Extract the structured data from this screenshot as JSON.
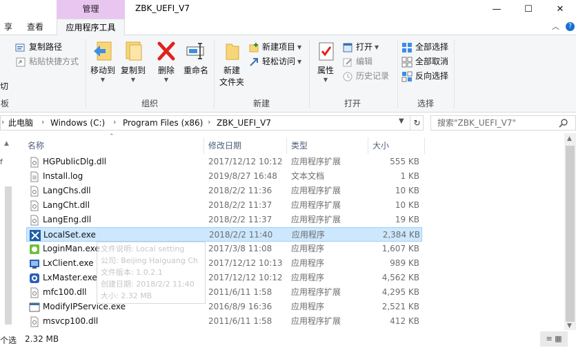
{
  "window": {
    "title": "ZBK_UEFI_V7",
    "context_group": "管理",
    "minimize": "—",
    "maximize": "☐",
    "close": "✕"
  },
  "tabs": {
    "share_partial": "享",
    "view": "查看",
    "app_tools": "应用程序工具",
    "collapse": "︿",
    "help": "?"
  },
  "ribbon": {
    "clipboard": {
      "copy_path": "复制路径",
      "paste_shortcut": "粘贴快捷方式",
      "cut_partial": "切",
      "group_partial": "板"
    },
    "organize": {
      "label": "组织",
      "move_to": "移动到",
      "copy_to": "复制到",
      "delete": "删除",
      "rename": "重命名"
    },
    "new": {
      "label": "新建",
      "new_folder_l1": "新建",
      "new_folder_l2": "文件夹",
      "new_item": "新建项目",
      "easy_access": "轻松访问"
    },
    "open": {
      "label": "打开",
      "properties": "属性",
      "open": "打开",
      "edit": "编辑",
      "history": "历史记录"
    },
    "select": {
      "label": "选择",
      "select_all": "全部选择",
      "select_none": "全部取消",
      "invert": "反向选择"
    }
  },
  "address": {
    "crumbs": [
      "此电脑",
      "Windows (C:)",
      "Program Files (x86)",
      "ZBK_UEFI_V7"
    ],
    "refresh": "↻",
    "search_placeholder": "搜索\"ZBK_UEFI_V7\""
  },
  "columns": [
    "名称",
    "修改日期",
    "类型",
    "大小"
  ],
  "files": [
    {
      "name": "HGPublicDlg.dll",
      "date": "2017/12/12 10:12",
      "type": "应用程序扩展",
      "size": "555 KB",
      "icon": "dll-file-icon"
    },
    {
      "name": "Install.log",
      "date": "2019/8/27 16:48",
      "type": "文本文档",
      "size": "1 KB",
      "icon": "text-file-icon"
    },
    {
      "name": "LangChs.dll",
      "date": "2018/2/2 11:36",
      "type": "应用程序扩展",
      "size": "10 KB",
      "icon": "dll-file-icon"
    },
    {
      "name": "LangCht.dll",
      "date": "2018/2/2 11:37",
      "type": "应用程序扩展",
      "size": "10 KB",
      "icon": "dll-file-icon"
    },
    {
      "name": "LangEng.dll",
      "date": "2018/2/2 11:37",
      "type": "应用程序扩展",
      "size": "19 KB",
      "icon": "dll-file-icon"
    },
    {
      "name": "LocalSet.exe",
      "date": "2018/2/2 11:40",
      "type": "应用程序",
      "size": "2,384 KB",
      "icon": "tools-exe-icon"
    },
    {
      "name": "LoginMan.exe",
      "date": "2017/3/8 11:08",
      "type": "应用程序",
      "size": "1,607 KB",
      "icon": "green-exe-icon"
    },
    {
      "name": "LxClient.exe",
      "date": "2017/12/12 10:13",
      "type": "应用程序",
      "size": "989 KB",
      "icon": "blue-exe-icon"
    },
    {
      "name": "LxMaster.exe",
      "date": "2017/12/12 10:12",
      "type": "应用程序",
      "size": "4,562 KB",
      "icon": "blue-round-exe-icon"
    },
    {
      "name": "mfc100.dll",
      "date": "2011/6/11 1:58",
      "type": "应用程序扩展",
      "size": "4,295 KB",
      "icon": "dll-file-icon"
    },
    {
      "name": "ModifyIPService.exe",
      "date": "2016/8/9 16:36",
      "type": "应用程序",
      "size": "2,521 KB",
      "icon": "exe-file-icon"
    },
    {
      "name": "msvcp100.dll",
      "date": "2011/6/11 1:58",
      "type": "应用程序扩展",
      "size": "412 KB",
      "icon": "dll-file-icon"
    }
  ],
  "tooltip": {
    "line1": "文件说明: Local setting",
    "line2": "公司: Beijing Haiguang Ch",
    "line3": "文件版本: 1.0.2.1",
    "line4": "创建日期: 2018/2/2 11:40",
    "line5": "大小: 2.32 MB"
  },
  "status": {
    "partial": "个选",
    "size": "2.32 MB",
    "view_buttons": "≡ ▦"
  },
  "colors": {
    "selection": "#cce8ff",
    "selection_border": "#99d1ff",
    "context_tab": "#e9c6f0",
    "ribbon_bg": "#f5f6f7"
  }
}
